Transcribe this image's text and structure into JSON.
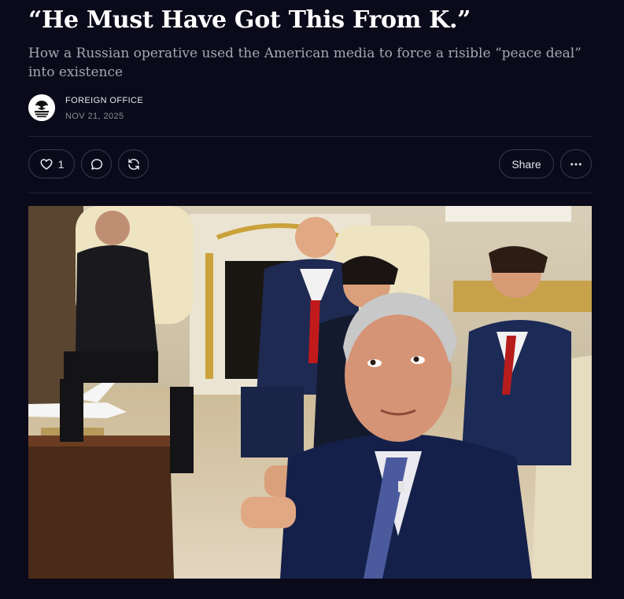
{
  "post": {
    "title": "“He Must Have Got This From K.”",
    "subtitle": "How a Russian operative used the American media to force a risible “peace deal” into existence"
  },
  "byline": {
    "author": "FOREIGN OFFICE",
    "date": "NOV 21, 2025",
    "avatar_icon": "foreign-office-logo"
  },
  "actions": {
    "like_count": "1",
    "share_label": "Share",
    "icons": [
      "heart-icon",
      "comment-icon",
      "restack-icon",
      "more-icon"
    ]
  },
  "colors": {
    "background": "#0a0a1a",
    "text": "#ffffff",
    "muted": "#a6a6b4",
    "border": "#3a3a4e"
  }
}
